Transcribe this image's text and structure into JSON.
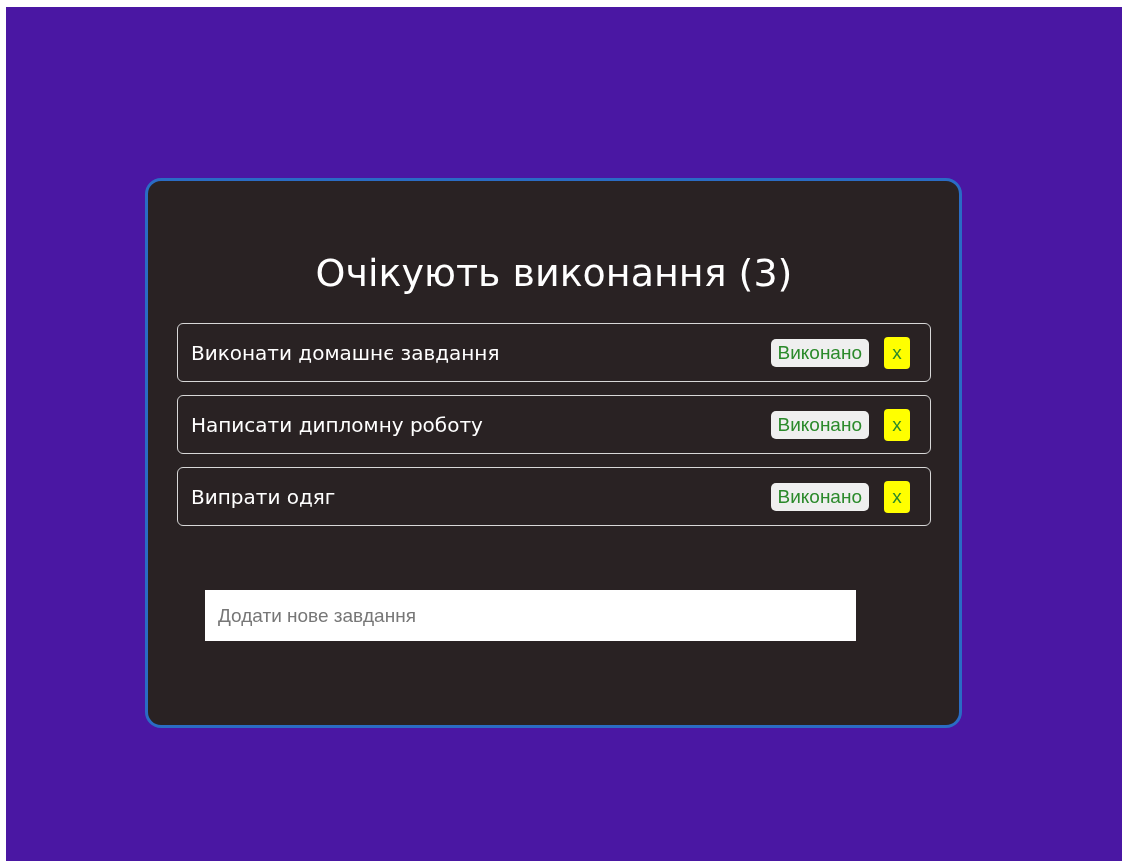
{
  "title": "Очікують виконання (3)",
  "tasks": [
    {
      "text": "Виконати домашнє завдання",
      "done_label": "Виконано",
      "delete_label": "x"
    },
    {
      "text": "Написати дипломну роботу",
      "done_label": "Виконано",
      "delete_label": "x"
    },
    {
      "text": "Випрати одяг",
      "done_label": "Виконано",
      "delete_label": "x"
    }
  ],
  "new_task": {
    "placeholder": "Додати нове завдання"
  }
}
